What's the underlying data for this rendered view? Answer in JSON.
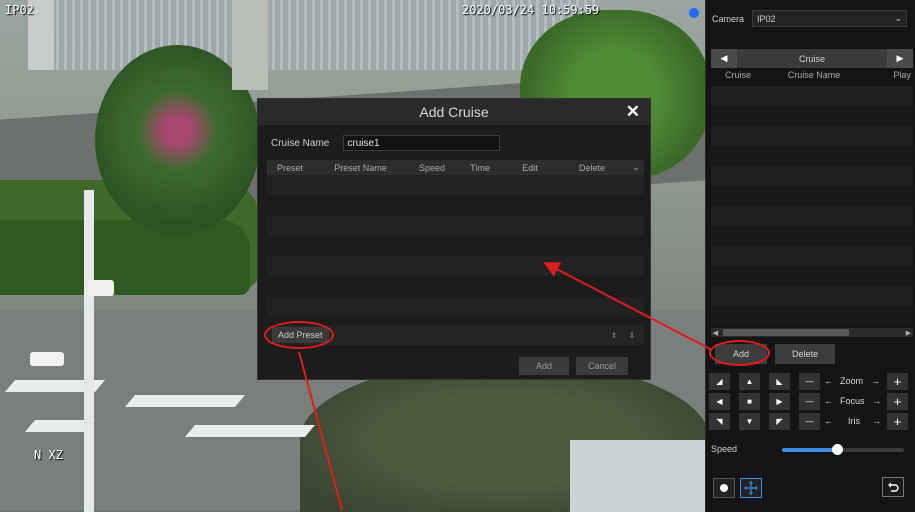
{
  "video": {
    "channel_label": "IP02",
    "timestamp": "2020/03/24 10:59:59",
    "corner_label": "N XZ"
  },
  "panel": {
    "camera_label": "Camera",
    "camera_value": "IP02",
    "cruise_title": "Cruise",
    "columns": [
      "Cruise",
      "Cruise Name",
      "Play"
    ],
    "add_label": "Add",
    "delete_label": "Delete",
    "zoom_label": "Zoom",
    "focus_label": "Focus",
    "iris_label": "Iris",
    "speed_label": "Speed",
    "speed_level": 0.45
  },
  "dialog": {
    "title": "Add Cruise",
    "cruise_name_label": "Cruise Name",
    "cruise_name_value": "cruise1",
    "columns": [
      "Preset",
      "Preset Name",
      "Speed",
      "Time",
      "Edit",
      "Delete"
    ],
    "add_preset_label": "Add Preset",
    "add_label": "Add",
    "cancel_label": "Cancel"
  },
  "colors": {
    "annotation_red": "#e21c1c",
    "accent_blue": "#3c8be6"
  }
}
